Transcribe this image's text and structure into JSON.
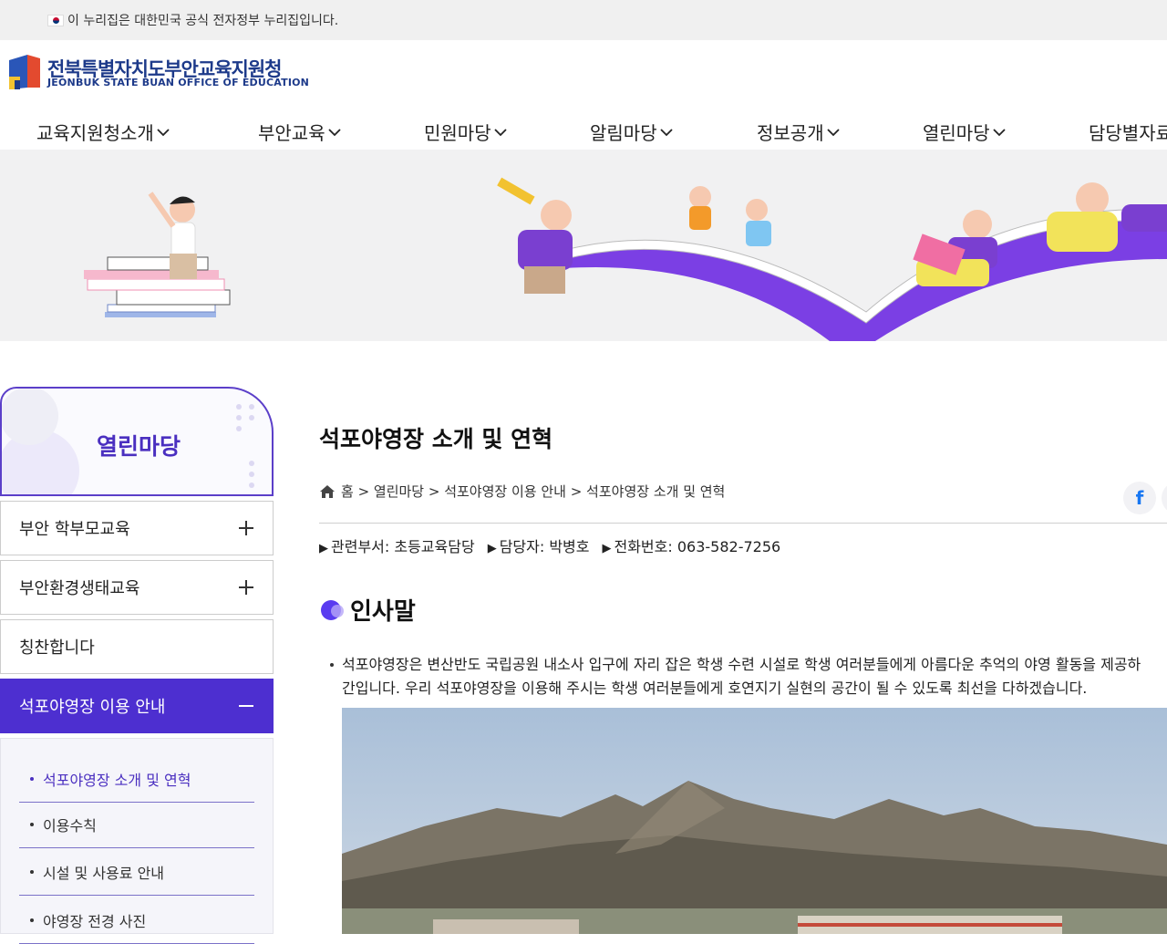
{
  "gov_bar": {
    "text": "이 누리집은 대한민국 공식 전자정부 누리집입니다."
  },
  "logo": {
    "title": "전북특별자치도부안교육지원청",
    "subtitle": "JEONBUK STATE BUAN OFFICE OF EDUCATION"
  },
  "gnb": {
    "items": [
      {
        "label": "교육지원청소개"
      },
      {
        "label": "부안교육"
      },
      {
        "label": "민원마당"
      },
      {
        "label": "알림마당"
      },
      {
        "label": "정보공개"
      },
      {
        "label": "열린마당"
      },
      {
        "label": "담당별자료"
      }
    ]
  },
  "sidebar": {
    "title": "열린마당",
    "menus": [
      {
        "label": "부안 학부모교육",
        "icon": "plus-icon"
      },
      {
        "label": "부안환경생태교육",
        "icon": "plus-icon"
      },
      {
        "label": "칭찬합니다",
        "icon": ""
      },
      {
        "label": "석포야영장 이용 안내",
        "icon": "minus-icon"
      }
    ],
    "submenu": [
      {
        "label": "석포야영장 소개 및 연혁",
        "active": true
      },
      {
        "label": "이용수칙"
      },
      {
        "label": "시설 및 사용료 안내"
      },
      {
        "label": "야영장 전경 사진"
      }
    ]
  },
  "content": {
    "page_title": "석포야영장 소개 및 연혁",
    "breadcrumb": "홈 > 열린마당 > 석포야영장 이용 안내 > 석포야영장 소개 및 연혁",
    "dept": "관련부서: 초등교육담당",
    "manager": "담당자: 박병호",
    "phone": "전화번호: 063-582-7256",
    "section_title": "인사말",
    "paragraph_line1": "석포야영장은 변산반도 국립공원 내소사 입구에 자리 잡은 학생 수련 시설로 학생 여러분들에게 아름다운 추억의 야영 활동을 제공하",
    "paragraph_line2": "간입니다. 우리 석포야영장을 이용해 주시는 학생 여러분들에게 호연지기 실현의 공간이 될 수 있도록 최선을 다하겠습니다.",
    "sns": "f"
  },
  "colors": {
    "accent": "#4d2fd0",
    "brand": "#1d3a8a"
  }
}
